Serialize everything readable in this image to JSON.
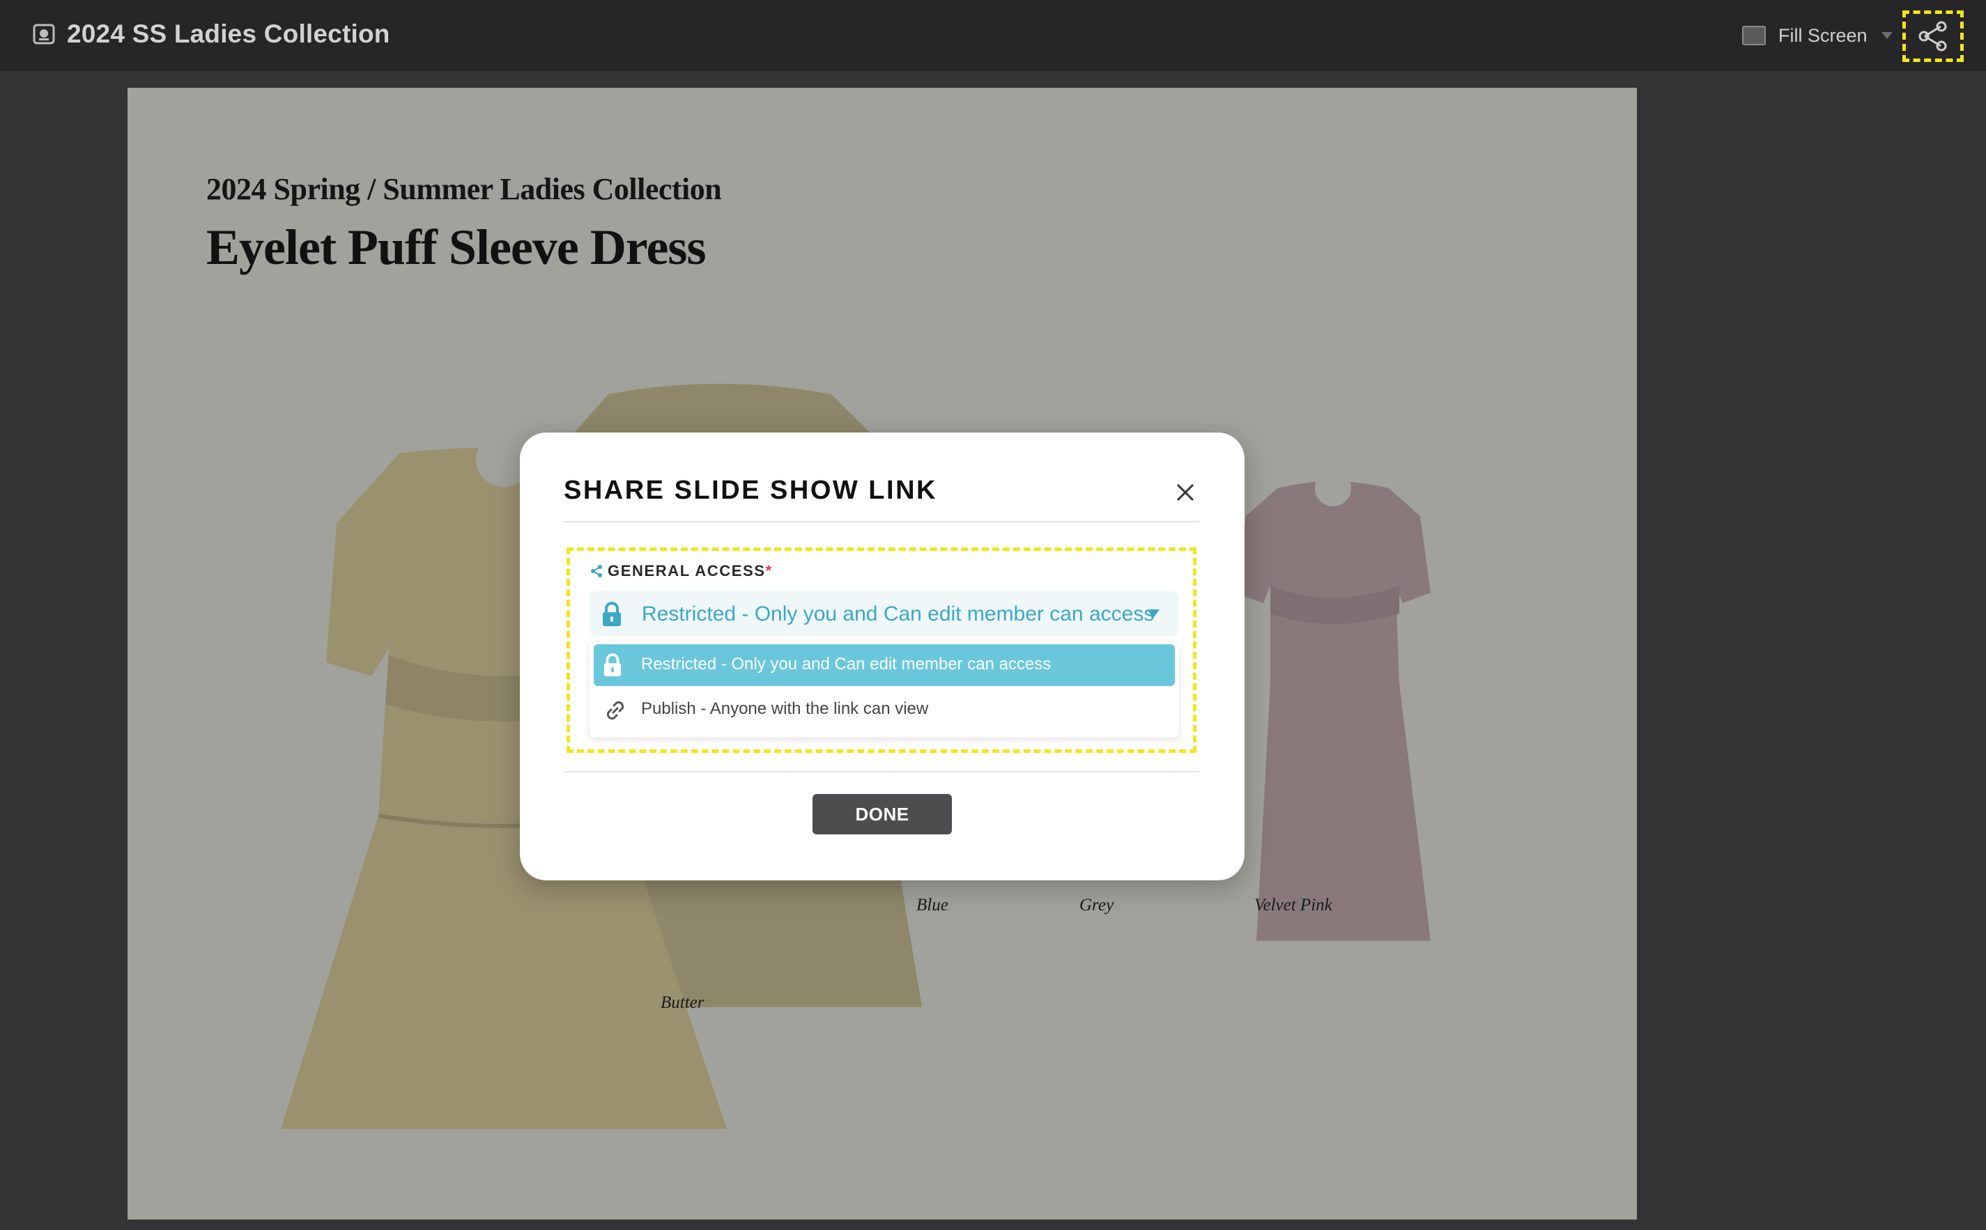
{
  "header": {
    "app_icon": "slideshow-icon",
    "title": "2024 SS Ladies Collection",
    "fill_screen_label": "Fill Screen",
    "share_icon": "share-icon"
  },
  "slide": {
    "subtitle": "2024 Spring / Summer Ladies Collection",
    "title": "Eyelet Puff Sleeve Dress",
    "colorways": [
      "Butter",
      "Blue",
      "Grey",
      "Velvet Pink"
    ]
  },
  "modal": {
    "title": "SHARE SLIDE SHOW LINK",
    "close_icon": "close-icon",
    "general_access_label": "GENERAL ACCESS",
    "required_mark": "*",
    "selected_value": "Restricted - Only you and Can edit member can access",
    "options": [
      {
        "label": "Restricted - Only you and Can edit member can access",
        "icon": "lock-icon",
        "selected": true
      },
      {
        "label": "Publish - Anyone with the link can view",
        "icon": "link-icon",
        "selected": false
      }
    ],
    "done_label": "DONE"
  },
  "colors": {
    "accent": "#3aa8c6",
    "selected_option": "#6ac7db",
    "highlight_dash": "#f3e51c",
    "slide_bg": "#a1a29b"
  }
}
